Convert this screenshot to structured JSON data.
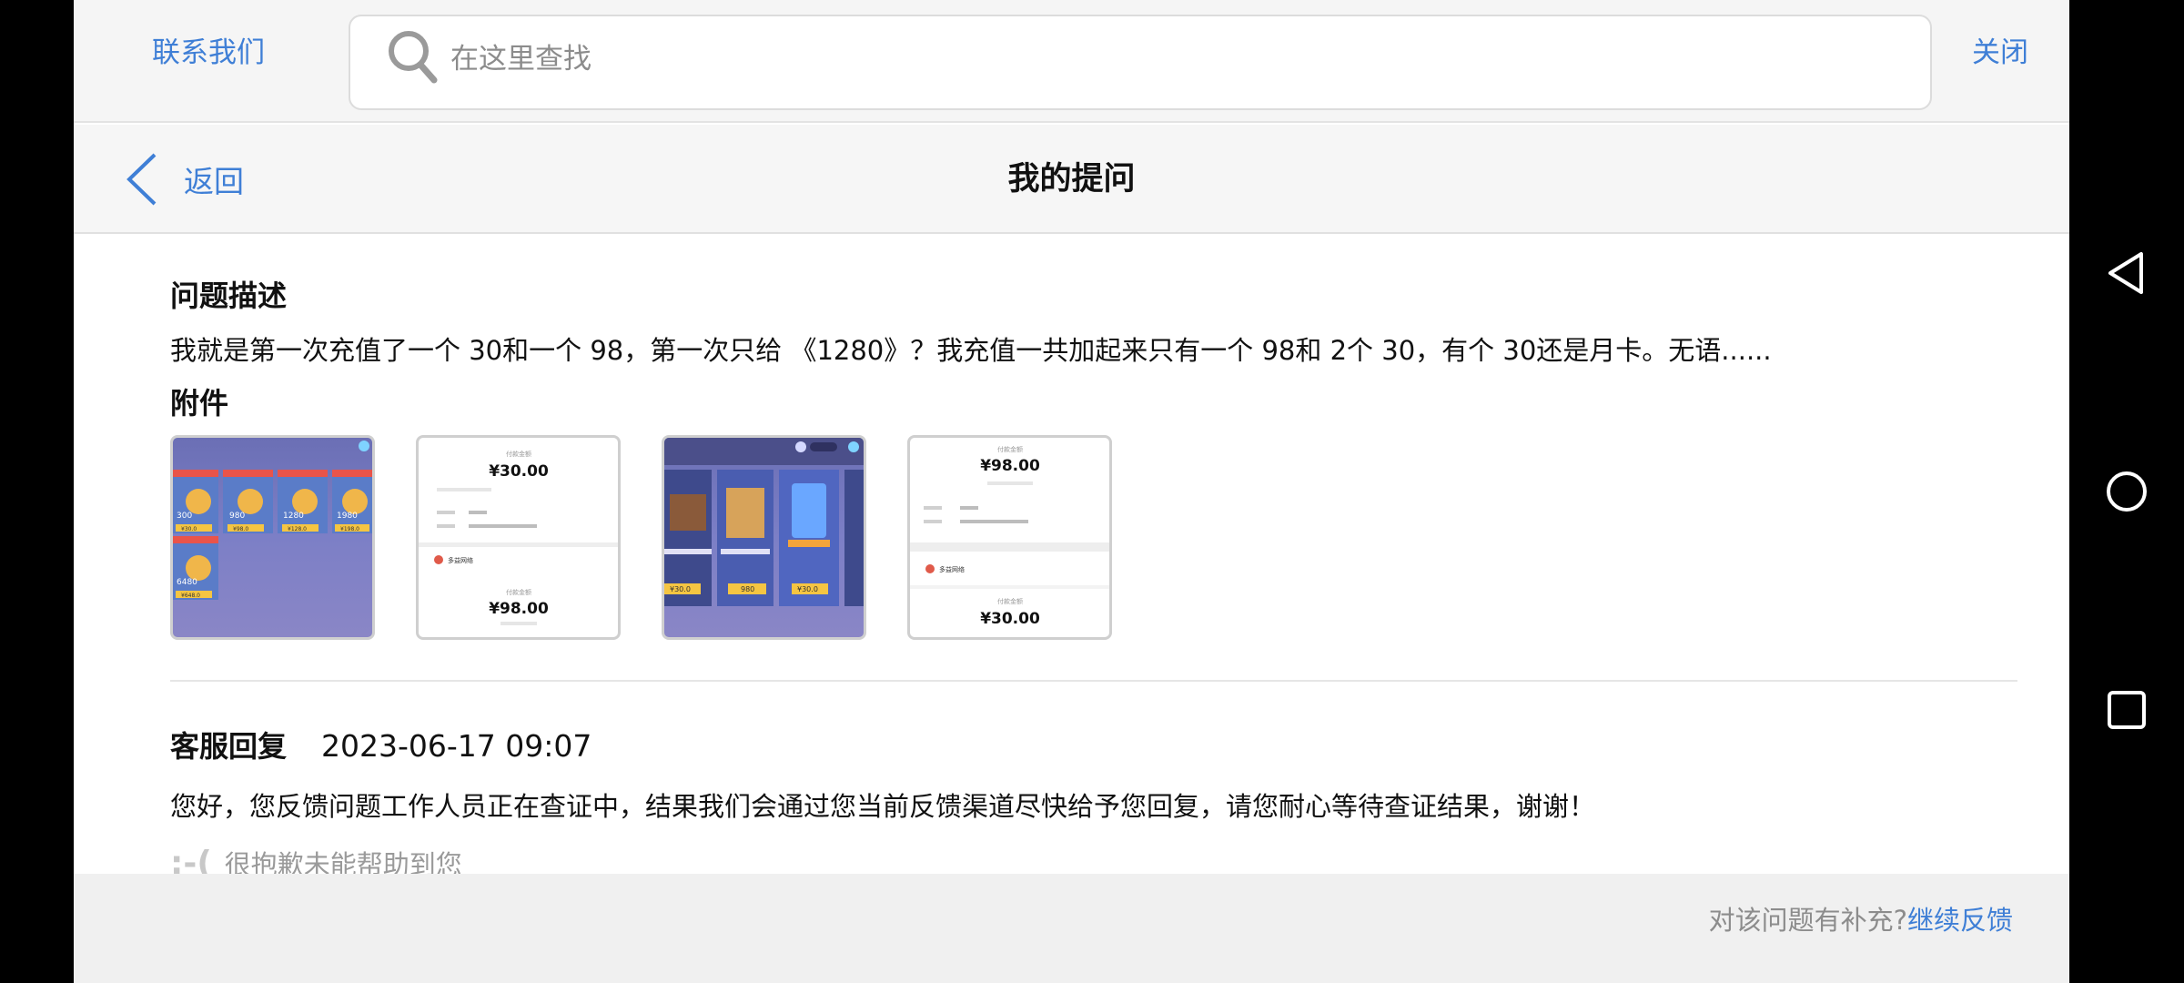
{
  "topbar": {
    "contact_label": "联系我们",
    "search_placeholder": "在这里查找",
    "close_label": "关闭"
  },
  "navbar": {
    "back_label": "返回",
    "title": "我的提问"
  },
  "question": {
    "heading": "问题描述",
    "text": "我就是第一次充值了一个 30和一个 98，第一次只给 《1280》？我充值一共加起来只有一个 98和 2个 30，有个 30还是月卡。无语......",
    "attachments_heading": "附件"
  },
  "attachments": {
    "thumb1": {
      "badges": [
        "300",
        "980",
        "1280",
        "1980",
        "6480"
      ],
      "prices": [
        "¥30.0",
        "¥98.0",
        "¥128.0",
        "¥198.0",
        "¥648.0"
      ]
    },
    "thumb2": {
      "label_top": "付款金额",
      "amount_top": "¥30.00",
      "merchant": "多益网络",
      "label_bottom": "付款金额",
      "amount_bottom": "¥98.00"
    },
    "thumb3": {
      "badge": "980",
      "prices": [
        "¥30.0",
        "¥30.0"
      ]
    },
    "thumb4": {
      "label_top": "付款金额",
      "amount_top": "¥98.00",
      "merchant": "多益网络",
      "label_bottom": "付款金额",
      "amount_bottom": "¥30.00"
    }
  },
  "reply": {
    "heading": "客服回复",
    "time": "2023-06-17 09:07",
    "text": "您好，您反馈问题工作人员正在查证中，结果我们会通过您当前反馈渠道尽快给予您回复，请您耐心等待查证结果，谢谢！",
    "sorry_face": ":-(",
    "sorry_text": "很抱歉未能帮助到您"
  },
  "bottombar": {
    "question": "对该问题有补充?",
    "link": "继续反馈"
  },
  "colors": {
    "accent": "#3f7fd6",
    "background": "#ffffff",
    "bar_background": "#f5f5f5"
  }
}
